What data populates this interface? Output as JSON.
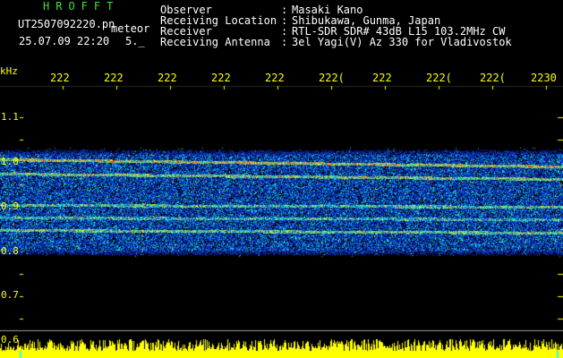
{
  "header": {
    "app_title": "HROFFT",
    "file_name": "UT2507092220.pn",
    "mode_label": "meteor",
    "date_time": "25.07.09 22:20",
    "dots": "5._"
  },
  "meta": [
    {
      "label": "Observer",
      "value": "Masaki Kano"
    },
    {
      "label": "Receiving Location",
      "value": "Shibukawa, Gunma, Japan"
    },
    {
      "label": "Receiver",
      "value": "RTL-SDR SDR# 43dB L15 103.2MHz CW"
    },
    {
      "label": "Receiving Antenna",
      "value": "3el Yagi(V) Az 330 for Vladivostok"
    }
  ],
  "axis": {
    "unit": "kHz",
    "y_ticks": [
      "1.1",
      "1.0",
      "0.9",
      "0.8",
      "0.7",
      "0.6"
    ],
    "x_ticks": [
      "222",
      "222",
      "222",
      "222",
      "222",
      "222(",
      "222",
      "222(",
      "222(",
      "2230"
    ]
  },
  "colors": {
    "header_green": "#3fe03f",
    "axis_yellow": "#ffff00",
    "background": "#000000",
    "waterfall_blue": "#1030c0",
    "power_bar": "#ffff00"
  }
}
